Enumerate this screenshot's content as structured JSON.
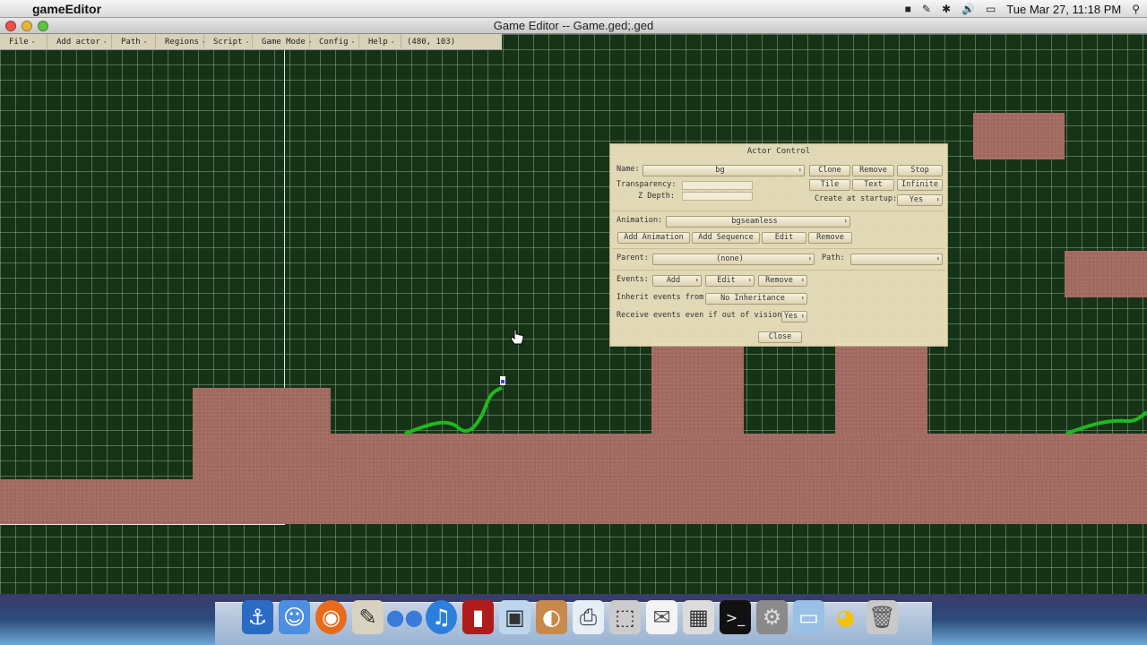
{
  "menubar": {
    "app_name": "gameEditor",
    "clock": "Tue Mar 27, 11:18 PM"
  },
  "window": {
    "title": "Game Editor -- Game.ged;.ged"
  },
  "editor_menu": {
    "items": [
      "File",
      "Add actor",
      "Path",
      "Regions",
      "Script",
      "Game Mode",
      "Config",
      "Help"
    ],
    "coords": "(480, 103)"
  },
  "actor_control": {
    "title": "Actor Control",
    "name_label": "Name:",
    "name_value": "bg",
    "transparency_label": "Transparency:",
    "zdepth_label": "Z Depth:",
    "clone": "Clone",
    "remove": "Remove",
    "stop": "Stop",
    "tile": "Tile",
    "text": "Text",
    "infinite": "Infinite",
    "create_at_startup_label": "Create at startup:",
    "create_at_startup_value": "Yes",
    "animation_label": "Animation:",
    "animation_value": "bgseamless",
    "add_animation": "Add Animation",
    "add_sequence": "Add Sequence",
    "edit": "Edit",
    "anim_remove": "Remove",
    "parent_label": "Parent:",
    "parent_value": "(none)",
    "path_label": "Path:",
    "path_value": "",
    "events_label": "Events:",
    "events_add": "Add",
    "events_edit": "Edit",
    "events_remove": "Remove",
    "inherit_label": "Inherit events from:",
    "inherit_value": "No Inheritance",
    "receive_label": "Receive events even if out of vision:",
    "receive_value": "Yes",
    "close": "Close"
  }
}
